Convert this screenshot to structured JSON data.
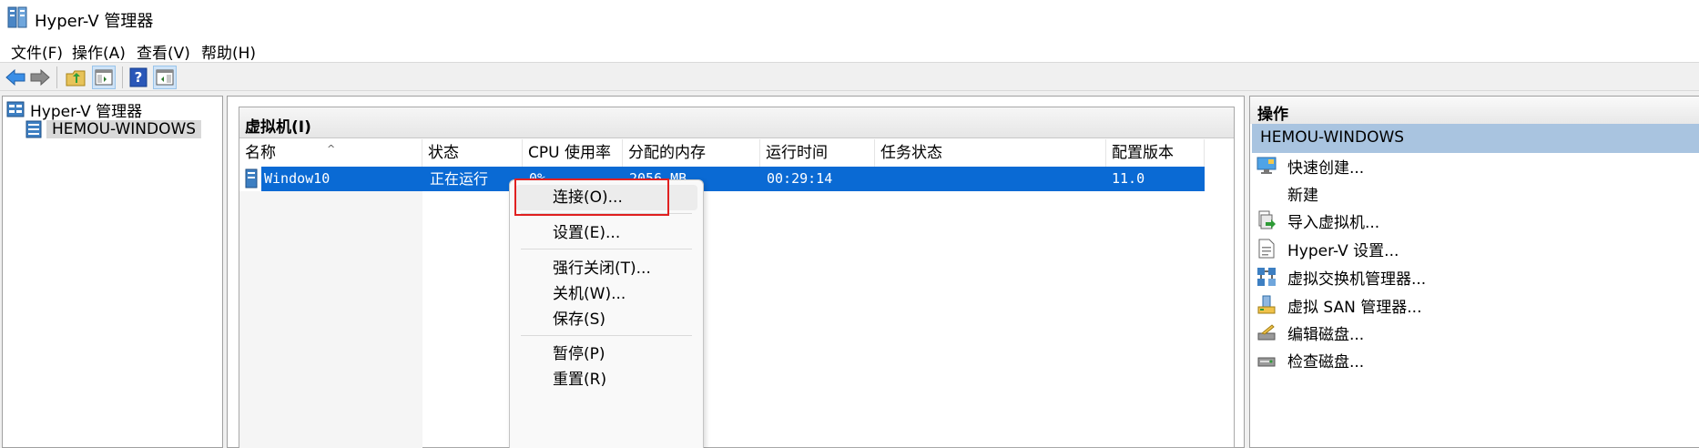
{
  "window": {
    "title": "Hyper-V 管理器"
  },
  "menu": [
    "文件(F)",
    "操作(A)",
    "查看(V)",
    "帮助(H)"
  ],
  "toolbar": {
    "buttons": [
      "back",
      "forward",
      "up",
      "show-hide-console-tree",
      "help",
      "show-hide-action-pane"
    ]
  },
  "tree": {
    "root": "Hyper-V 管理器",
    "host": "HEMOU-WINDOWS"
  },
  "vm_panel": {
    "title": "虚拟机(I)",
    "columns": [
      "名称",
      "状态",
      "CPU 使用率",
      "分配的内存",
      "运行时间",
      "任务状态",
      "配置版本"
    ],
    "rows": [
      {
        "name": "Window10",
        "state": "正在运行",
        "cpu": "0%",
        "memory": "2056 MB",
        "uptime": "00:29:14",
        "task": "",
        "version": "11.0"
      }
    ]
  },
  "context_menu": {
    "groups": [
      [
        "连接(O)..."
      ],
      [
        "设置(E)..."
      ],
      [
        "强行关闭(T)...",
        "关机(W)...",
        "保存(S)"
      ],
      [
        "暂停(P)",
        "重置(R)"
      ]
    ],
    "highlighted": "连接(O)..."
  },
  "actions": {
    "title": "操作",
    "host": "HEMOU-WINDOWS",
    "items": [
      "快速创建...",
      "新建",
      "导入虚拟机...",
      "Hyper-V 设置...",
      "虚拟交换机管理器...",
      "虚拟 SAN 管理器...",
      "编辑磁盘...",
      "检查磁盘..."
    ]
  },
  "colors": {
    "selection": "#0a6ad4",
    "highlight_box": "#e02020",
    "host_band": "#a9c4e0"
  }
}
